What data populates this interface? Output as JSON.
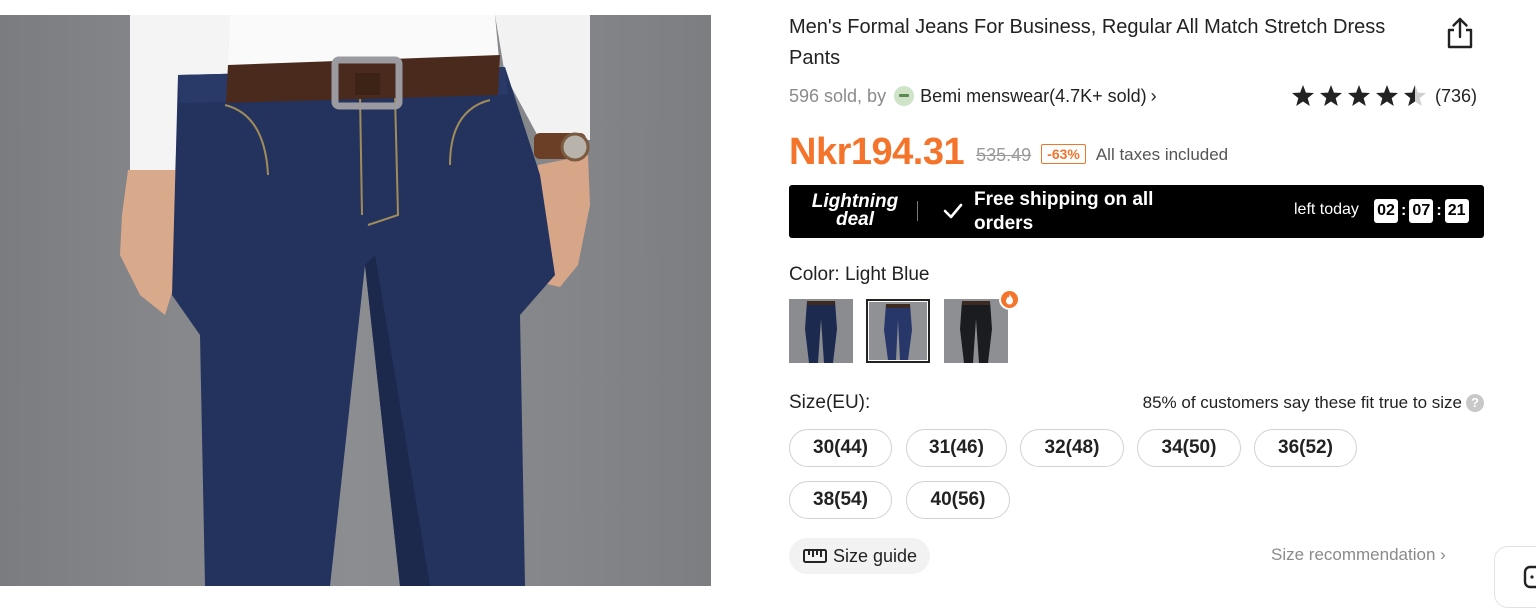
{
  "product": {
    "title": "Men's Formal Jeans For Business, Regular All Match Stretch Dress Pants",
    "sold_text": "596 sold, by",
    "store_name": "Bemi menswear(4.7K+ sold)",
    "rating_value": 4.5,
    "review_count": "(736)"
  },
  "price": {
    "current": "Nkr194.31",
    "original": "535.49",
    "discount": "-63%",
    "tax_note": "All taxes included",
    "accent_color": "#f5742b"
  },
  "deal": {
    "badge": "Lightning deal",
    "badge_line1": "Lightning",
    "badge_line2": "deal",
    "shipping": "Free shipping on all orders",
    "left_label": "left today",
    "timer": [
      "02",
      "07",
      "21"
    ]
  },
  "color": {
    "label": "Color: Light Blue",
    "swatches": [
      "dark-blue-jeans",
      "light-blue-jeans",
      "black-jeans"
    ],
    "selected_index": 1
  },
  "size": {
    "label": "Size(EU):",
    "fit_note": "85% of customers say these fit true to size",
    "help_glyph": "?",
    "options": [
      "30(44)",
      "31(46)",
      "32(48)",
      "34(50)",
      "36(52)",
      "38(54)",
      "40(56)"
    ]
  },
  "footer": {
    "size_guide": "Size guide",
    "size_recommendation": "Size recommendation ›"
  },
  "icons": {
    "share": "share-icon",
    "star": "star-icon",
    "check": "check-icon",
    "ruler": "ruler-icon",
    "hot": "flame-icon",
    "chat": "chat-icon"
  }
}
